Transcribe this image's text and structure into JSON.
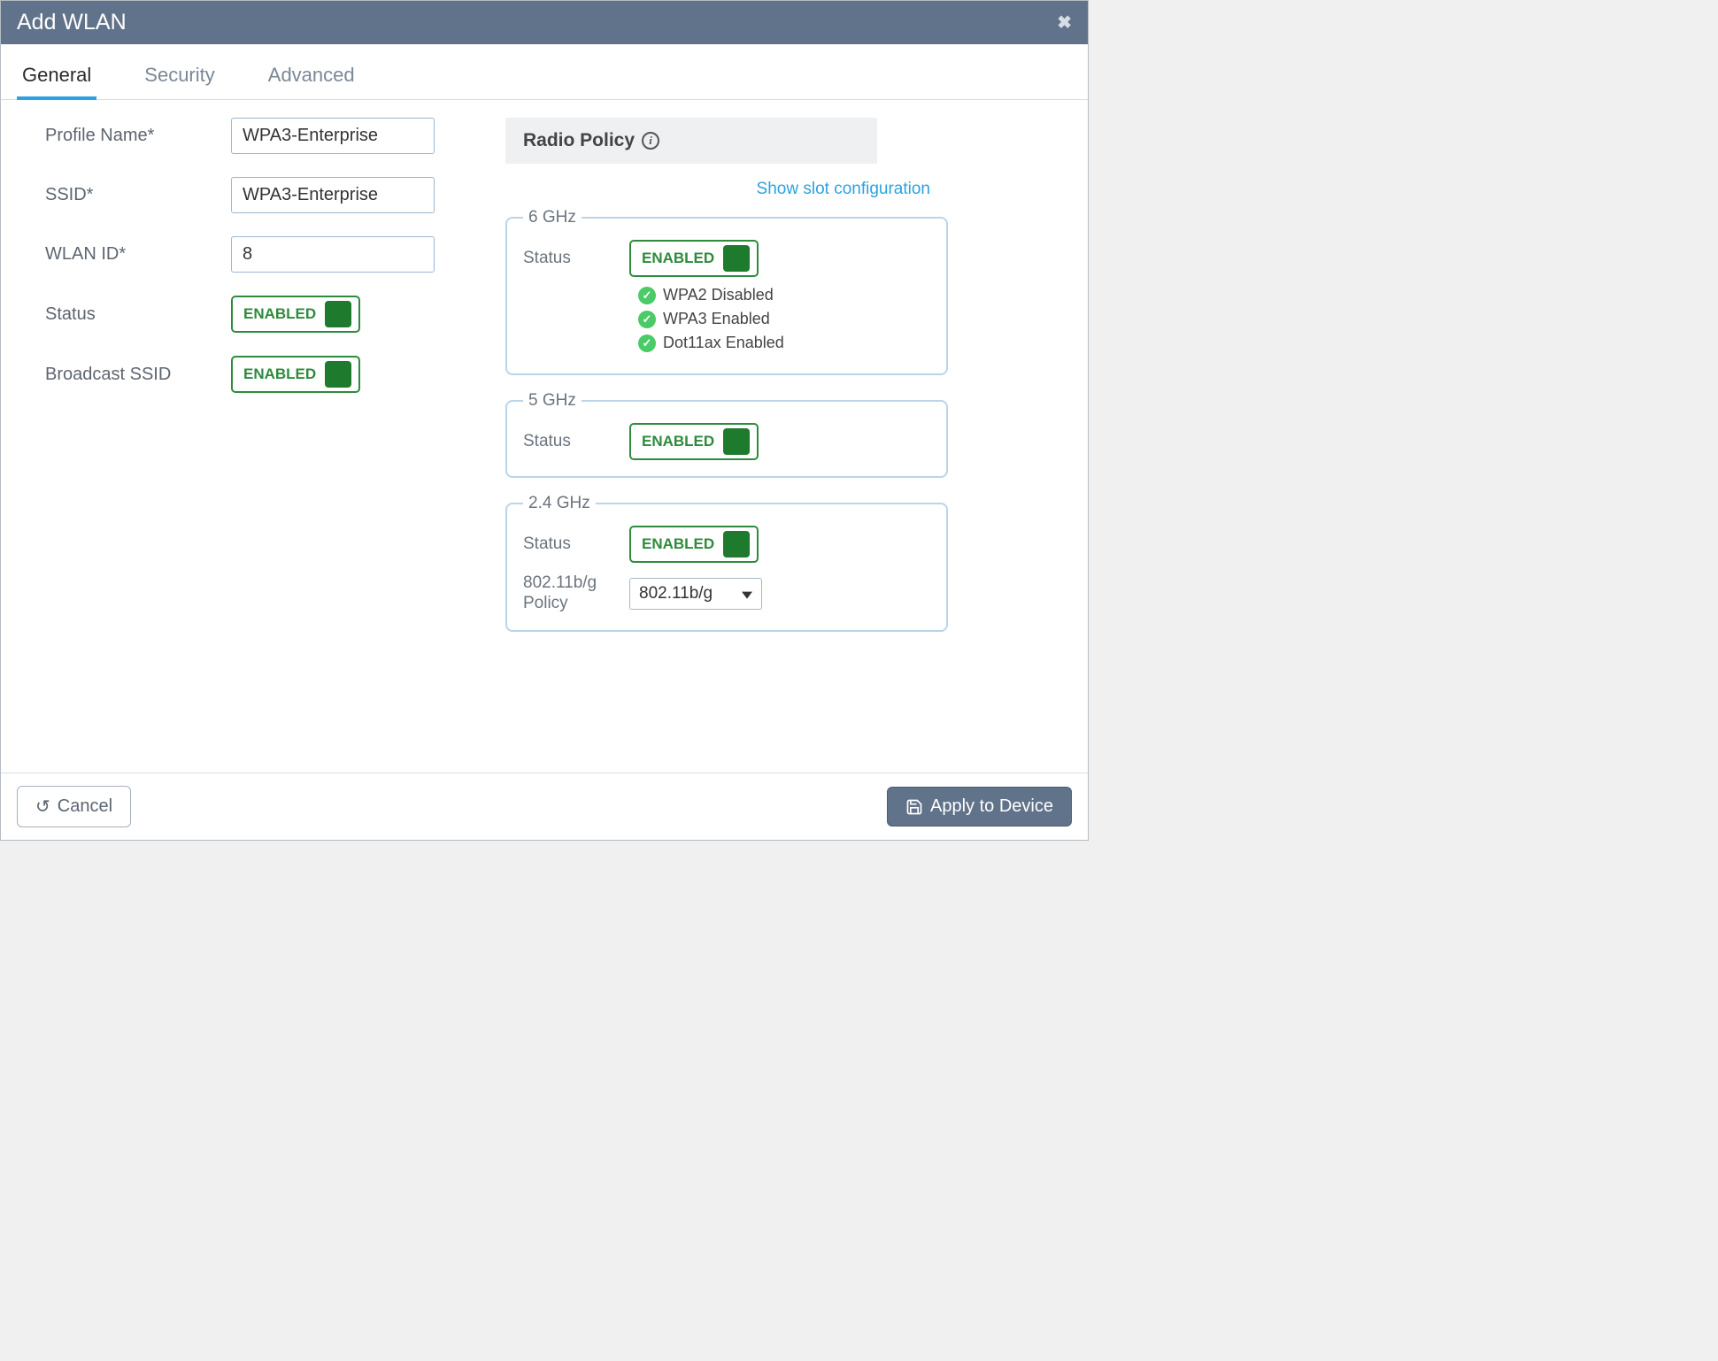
{
  "dialog": {
    "title": "Add WLAN"
  },
  "tabs": {
    "general": "General",
    "security": "Security",
    "advanced": "Advanced"
  },
  "form": {
    "profile_name_label": "Profile Name*",
    "profile_name_value": "WPA3-Enterprise",
    "ssid_label": "SSID*",
    "ssid_value": "WPA3-Enterprise",
    "wlan_id_label": "WLAN ID*",
    "wlan_id_value": "8",
    "status_label": "Status",
    "status_toggle": "ENABLED",
    "broadcast_label": "Broadcast SSID",
    "broadcast_toggle": "ENABLED"
  },
  "radio": {
    "header": "Radio Policy",
    "slot_link": "Show slot configuration",
    "band6": {
      "legend": "6 GHz",
      "status_label": "Status",
      "status_toggle": "ENABLED",
      "checks": {
        "wpa2": "WPA2 Disabled",
        "wpa3": "WPA3 Enabled",
        "dot11ax": "Dot11ax Enabled"
      }
    },
    "band5": {
      "legend": "5 GHz",
      "status_label": "Status",
      "status_toggle": "ENABLED"
    },
    "band24": {
      "legend": "2.4 GHz",
      "status_label": "Status",
      "status_toggle": "ENABLED",
      "policy_label": "802.11b/g Policy",
      "policy_value": "802.11b/g"
    }
  },
  "footer": {
    "cancel": "Cancel",
    "apply": "Apply to Device"
  }
}
